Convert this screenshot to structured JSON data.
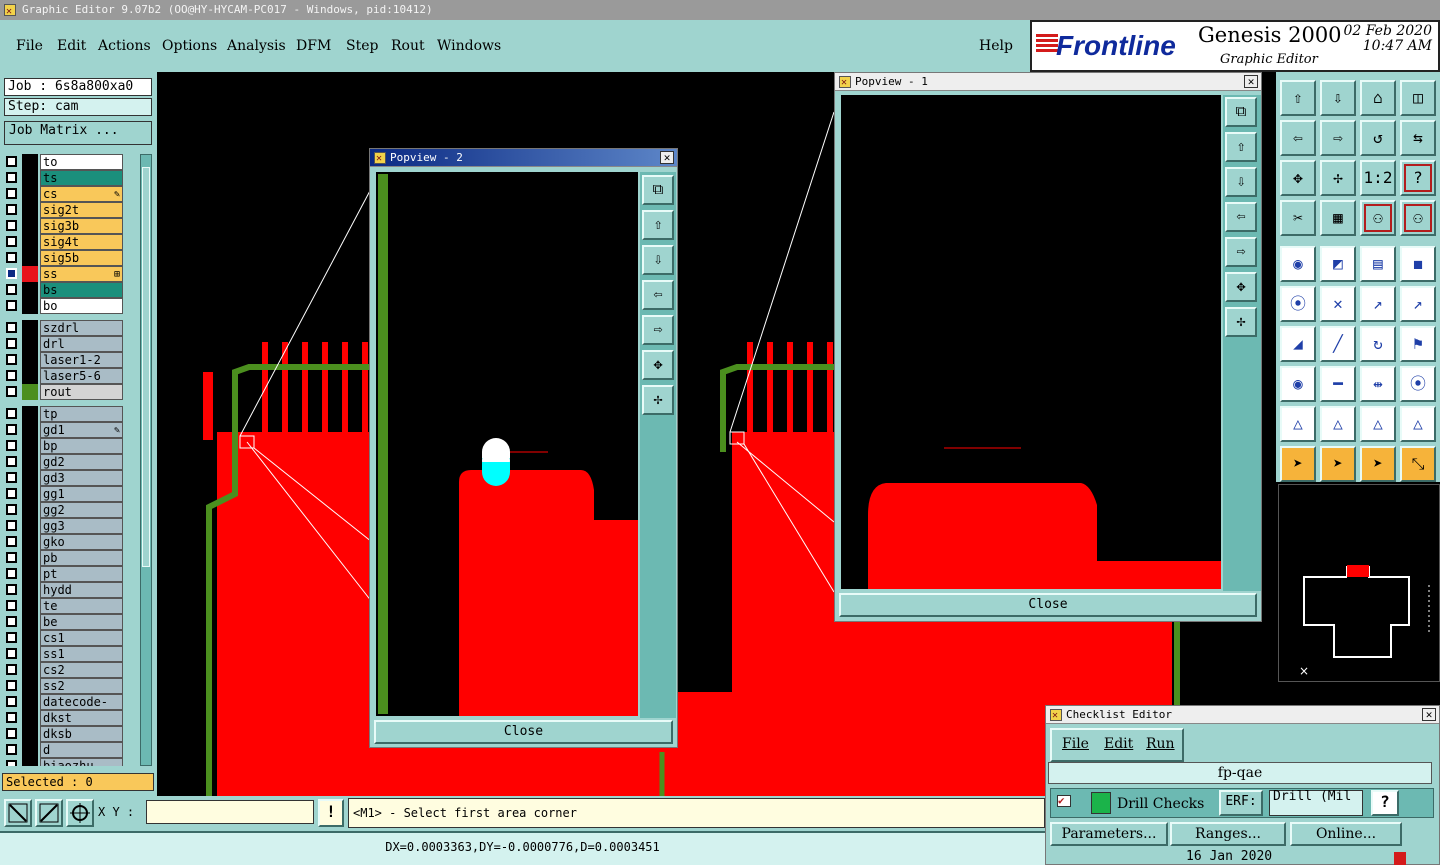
{
  "window": {
    "title": "Graphic Editor 9.07b2 (OO@HY-HYCAM-PC017 - Windows, pid:10412)"
  },
  "menu": {
    "file": "File",
    "edit": "Edit",
    "actions": "Actions",
    "options": "Options",
    "analysis": "Analysis",
    "dfm": "DFM",
    "step": "Step",
    "rout": "Rout",
    "windows": "Windows",
    "help": "Help"
  },
  "brand": {
    "logo": "Frontline",
    "product": "Genesis 2000",
    "subtitle": "Graphic Editor",
    "date": "02 Feb 2020",
    "time": "10:47 AM"
  },
  "job": {
    "job_label": "Job : 6s8a800xa0",
    "step_label": "Step: cam",
    "matrix_button": "Job Matrix ..."
  },
  "layers": [
    {
      "name": "to",
      "color": "#ffffff",
      "swatch": "#000000"
    },
    {
      "name": "ts",
      "color": "#1b8f7c",
      "swatch": "#000000"
    },
    {
      "name": "cs",
      "color": "#f9c85a",
      "swatch": "#000000",
      "mark": "brush"
    },
    {
      "name": "sig2t",
      "color": "#f9c85a",
      "swatch": "#000000"
    },
    {
      "name": "sig3b",
      "color": "#f9c85a",
      "swatch": "#000000"
    },
    {
      "name": "sig4t",
      "color": "#f9c85a",
      "swatch": "#000000"
    },
    {
      "name": "sig5b",
      "color": "#f9c85a",
      "swatch": "#000000"
    },
    {
      "name": "ss",
      "color": "#f9c85a",
      "swatch": "#e8141b",
      "mark": "grid",
      "active": true
    },
    {
      "name": "bs",
      "color": "#1b8f7c",
      "swatch": "#000000"
    },
    {
      "name": "bo",
      "color": "#ffffff",
      "swatch": "#000000"
    },
    {
      "gap": true
    },
    {
      "name": "szdrl",
      "color": "#a9bcc6",
      "swatch": "#000000"
    },
    {
      "name": "drl",
      "color": "#a9bcc6",
      "swatch": "#000000"
    },
    {
      "name": "laser1-2",
      "color": "#a9bcc6",
      "swatch": "#000000"
    },
    {
      "name": "laser5-6",
      "color": "#a9bcc6",
      "swatch": "#000000"
    },
    {
      "name": "rout",
      "color": "#d4d4d4",
      "swatch": "#4b8f1e"
    },
    {
      "gap": true
    },
    {
      "name": "tp",
      "color": "#a9bcc6",
      "swatch": "#000000"
    },
    {
      "name": "gd1",
      "color": "#a9bcc6",
      "swatch": "#000000",
      "mark": "brush"
    },
    {
      "name": "bp",
      "color": "#a9bcc6",
      "swatch": "#000000"
    },
    {
      "name": "gd2",
      "color": "#a9bcc6",
      "swatch": "#000000"
    },
    {
      "name": "gd3",
      "color": "#a9bcc6",
      "swatch": "#000000"
    },
    {
      "name": "gg1",
      "color": "#a9bcc6",
      "swatch": "#000000"
    },
    {
      "name": "gg2",
      "color": "#a9bcc6",
      "swatch": "#000000"
    },
    {
      "name": "gg3",
      "color": "#a9bcc6",
      "swatch": "#000000"
    },
    {
      "name": "gko",
      "color": "#a9bcc6",
      "swatch": "#000000"
    },
    {
      "name": "pb",
      "color": "#a9bcc6",
      "swatch": "#000000"
    },
    {
      "name": "pt",
      "color": "#a9bcc6",
      "swatch": "#000000"
    },
    {
      "name": "hydd",
      "color": "#a9bcc6",
      "swatch": "#000000"
    },
    {
      "name": "te",
      "color": "#a9bcc6",
      "swatch": "#000000"
    },
    {
      "name": "be",
      "color": "#a9bcc6",
      "swatch": "#000000"
    },
    {
      "name": "cs1",
      "color": "#a9bcc6",
      "swatch": "#000000"
    },
    {
      "name": "ss1",
      "color": "#a9bcc6",
      "swatch": "#000000"
    },
    {
      "name": "cs2",
      "color": "#a9bcc6",
      "swatch": "#000000"
    },
    {
      "name": "ss2",
      "color": "#a9bcc6",
      "swatch": "#000000"
    },
    {
      "name": "datecode-pbe",
      "color": "#a9bcc6",
      "swatch": "#000000"
    },
    {
      "name": "dkst",
      "color": "#a9bcc6",
      "swatch": "#000000"
    },
    {
      "name": "dksb",
      "color": "#a9bcc6",
      "swatch": "#000000"
    },
    {
      "name": "d",
      "color": "#a9bcc6",
      "swatch": "#000000"
    },
    {
      "name": "biaozhu",
      "color": "#a9bcc6",
      "swatch": "#000000"
    }
  ],
  "selected": "Selected : 0",
  "bottom": {
    "xy_label": "X Y :",
    "xy_value": "",
    "prompt": "<M1> - Select first area corner",
    "status": "DX=0.0003363,DY=-0.0000776,D=0.0003451",
    "prompt_icon": "!"
  },
  "popview1": {
    "title": "Popview - 1",
    "close": "Close"
  },
  "popview2": {
    "title": "Popview - 2",
    "close": "Close"
  },
  "checklist": {
    "title": "Checklist Editor",
    "menu": {
      "file": "File",
      "edit": "Edit",
      "run": "Run"
    },
    "name": "fp-qae",
    "item": "Drill Checks",
    "erf_label": "ERF:",
    "erf_value": "Drill (Mil",
    "help": "?",
    "parameters": "Parameters...",
    "ranges": "Ranges...",
    "online": "Online...",
    "date": "16 Jan 2020"
  },
  "colors": {
    "teal": "#9fd4cf",
    "copper": "#ff0000",
    "rout": "#4b8f1e",
    "cyan": "#00ffff",
    "layer_active": "#f9c85a"
  }
}
